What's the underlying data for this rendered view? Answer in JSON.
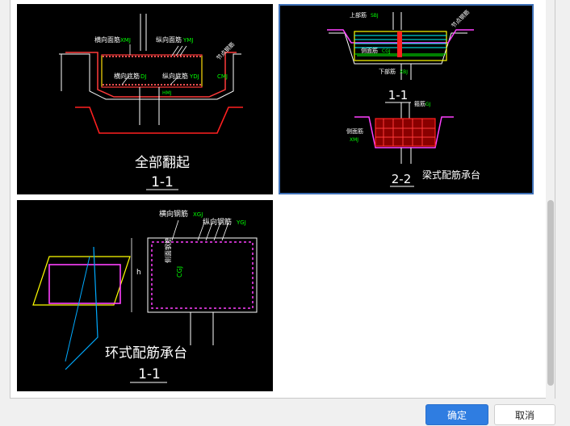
{
  "images": [
    {
      "caption_main": "全部翻起",
      "caption_section": "1-1",
      "labels": {
        "transverse_top": "横向面筋",
        "transverse_top_code": "XMJ",
        "longitudinal_top": "纵向面筋",
        "longitudinal_top_code": "YMJ",
        "transverse_bottom": "横向底筋",
        "transverse_bottom_code": "DJ",
        "longitudinal_bottom": "纵向底筋",
        "longitudinal_bottom_code": "YDJ",
        "cmj": "CMJ",
        "bottom_hmj": "HMJ",
        "side_label": "节点钢筋"
      }
    },
    {
      "caption_main": "梁式配筋承台",
      "caption_section_a": "1-1",
      "caption_section_b": "2-2",
      "labels": {
        "top_bar": "上部筋",
        "top_bar_code": "SBJ",
        "side_bar": "侧面筋",
        "side_bar_code": "CGJ",
        "bottom_bar": "下部筋",
        "bottom_bar_code": "XBJ",
        "stirrup": "箍筋",
        "stirrup_code": "GJ",
        "side_face": "侧面筋",
        "side_face_code": "XMJ",
        "side_note": "节点钢筋"
      }
    },
    {
      "caption_main": "环式配筋承台",
      "caption_section": "1-1",
      "labels": {
        "transverse": "横向钢筋",
        "transverse_code": "XGJ",
        "longitudinal": "纵向钢筋",
        "longitudinal_code": "YGJ",
        "side": "侧面钢筋",
        "side_code": "CGJ",
        "height": "h"
      }
    }
  ],
  "buttons": {
    "ok": "确定",
    "cancel": "取消"
  },
  "colors": {
    "accent": "#2f7de1",
    "selected_border": "#3d6fb6"
  }
}
